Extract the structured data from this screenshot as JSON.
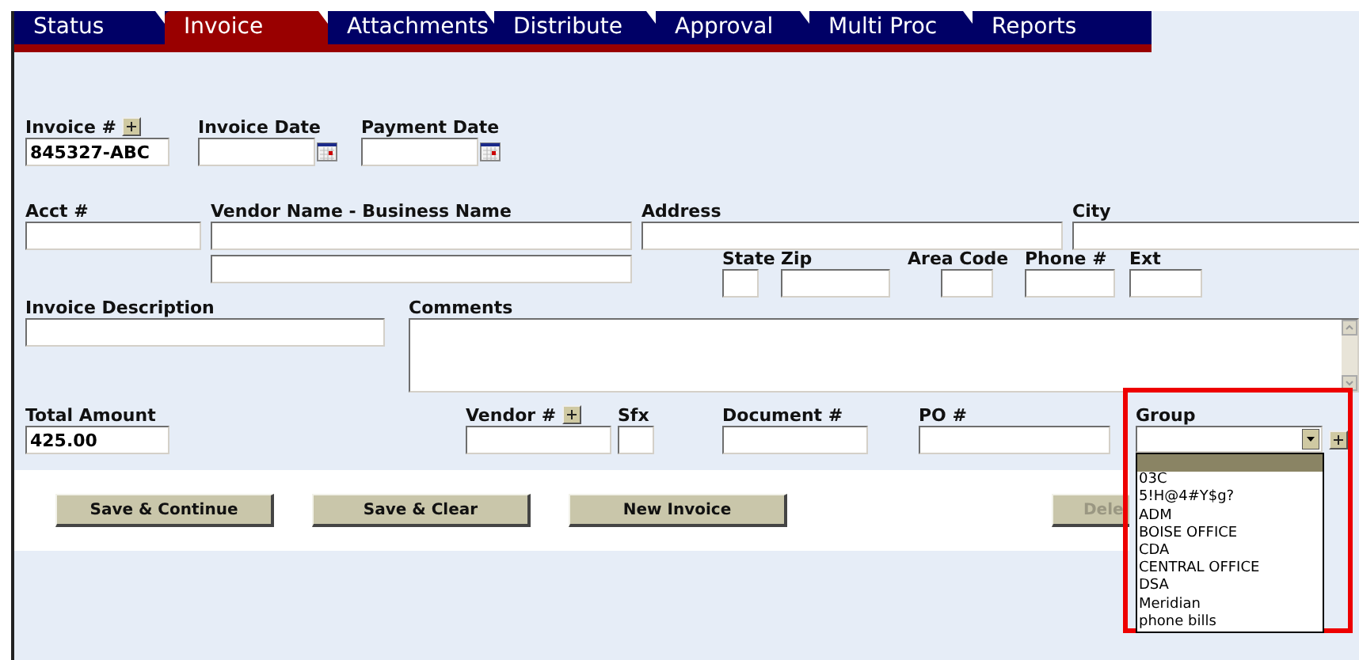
{
  "tabs": [
    {
      "label": "Status",
      "selected": false
    },
    {
      "label": "Invoice",
      "selected": true
    },
    {
      "label": "Attachments",
      "selected": false
    },
    {
      "label": "Distribute",
      "selected": false
    },
    {
      "label": "Approval",
      "selected": false
    },
    {
      "label": "Multi Proc",
      "selected": false
    },
    {
      "label": "Reports",
      "selected": false
    }
  ],
  "invoice_number": {
    "label": "**Invoice** #",
    "value": "845327-ABC"
  },
  "invoice_date": {
    "label": "Invoice Date"
  },
  "payment_date": {
    "label": "Payment Date"
  },
  "acct": {
    "label": "**Acct** #"
  },
  "vendor_name": {
    "label": "Vendor Name - Business Name"
  },
  "address": {
    "label": "Address"
  },
  "city": {
    "label": "City"
  },
  "state": {
    "label": "State"
  },
  "zip": {
    "label": "Zip"
  },
  "area_code": {
    "label": "Area Code"
  },
  "phone": {
    "label": "**Phone** #"
  },
  "ext": {
    "label": "Ext"
  },
  "invoice_description": {
    "label": "Invoice Description"
  },
  "comments": {
    "label": "Comments"
  },
  "total_amount": {
    "label": "Total Amount",
    "value": "425.00"
  },
  "vendor_number": {
    "label": "**Vendor** #"
  },
  "sfx": {
    "label": "Sfx"
  },
  "document": {
    "label": "**Document** #"
  },
  "po": {
    "label": "**PO** #"
  },
  "group": {
    "label": "Group",
    "expanded": true,
    "blank_option_highlighted": true,
    "options": [
      "03C",
      "5!H@4#Y$g?",
      "ADM",
      "BOISE OFFICE",
      "CDA",
      "CENTRAL OFFICE",
      "DSA",
      "Meridian",
      "phone bills"
    ]
  },
  "buttons": [
    {
      "label": "Save & Continue",
      "disabled": false
    },
    {
      "label": "Save & Clear",
      "disabled": false
    },
    {
      "label": "New Invoice",
      "disabled": false
    },
    {
      "label": "Dele",
      "disabled": true
    }
  ]
}
